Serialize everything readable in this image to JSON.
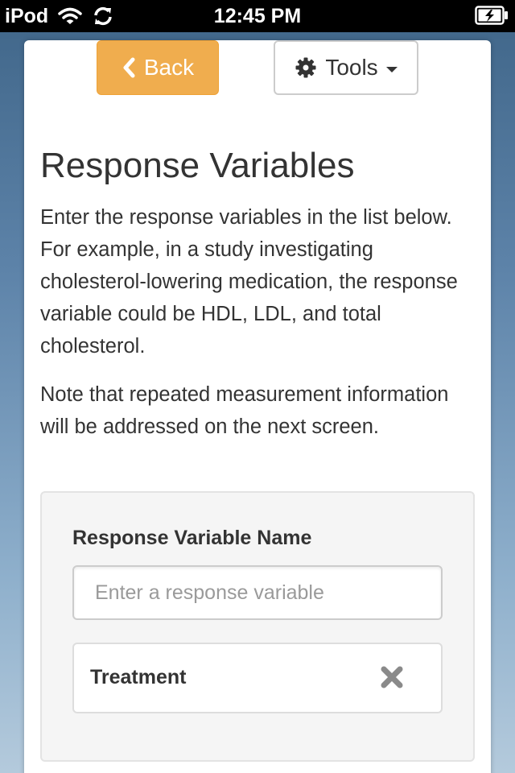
{
  "status_bar": {
    "carrier": "iPod",
    "time": "12:45 PM"
  },
  "nav": {
    "back_label": "Back",
    "tools_label": "Tools"
  },
  "page": {
    "title": "Response Variables",
    "intro": "Enter the response variables in the list below. For example, in a study investigating cholesterol-lowering medication, the response variable could be HDL, LDL, and total cholesterol.",
    "note": "Note that repeated measurement information will be addressed on the next screen."
  },
  "form": {
    "label": "Response Variable Name",
    "input_value": "",
    "input_placeholder": "Enter a response variable",
    "items": [
      {
        "label": "Treatment"
      }
    ]
  },
  "icons": {
    "back": "chevron-left-icon",
    "tools": "gear-icon",
    "tools_menu": "caret-down-icon",
    "remove": "close-icon",
    "wifi": "wifi-icon",
    "sync": "sync-icon",
    "battery": "battery-charging-icon"
  },
  "colors": {
    "back_button": "#f0ad4e",
    "well_background": "#f5f5f5",
    "text": "#333333"
  }
}
